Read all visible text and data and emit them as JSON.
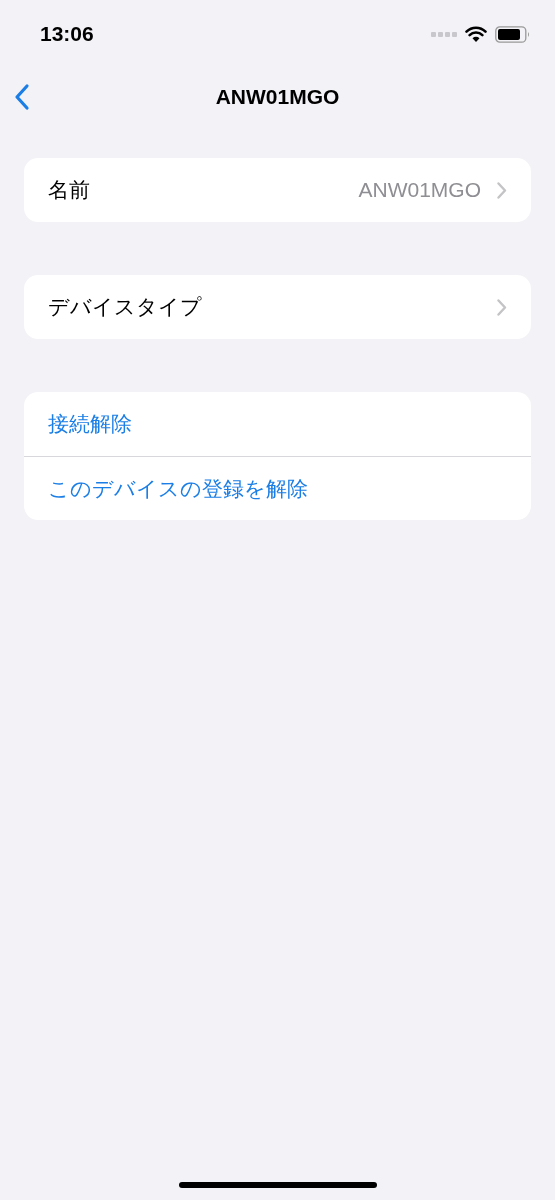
{
  "status_bar": {
    "time": "13:06"
  },
  "nav": {
    "title": "ANW01MGO"
  },
  "groups": [
    {
      "rows": [
        {
          "kind": "nav",
          "label": "名前",
          "value": "ANW01MGO"
        }
      ]
    },
    {
      "rows": [
        {
          "kind": "nav",
          "label": "デバイスタイプ"
        }
      ]
    },
    {
      "rows": [
        {
          "kind": "action",
          "label": "接続解除"
        },
        {
          "kind": "action",
          "label": "このデバイスの登録を解除"
        }
      ]
    }
  ]
}
